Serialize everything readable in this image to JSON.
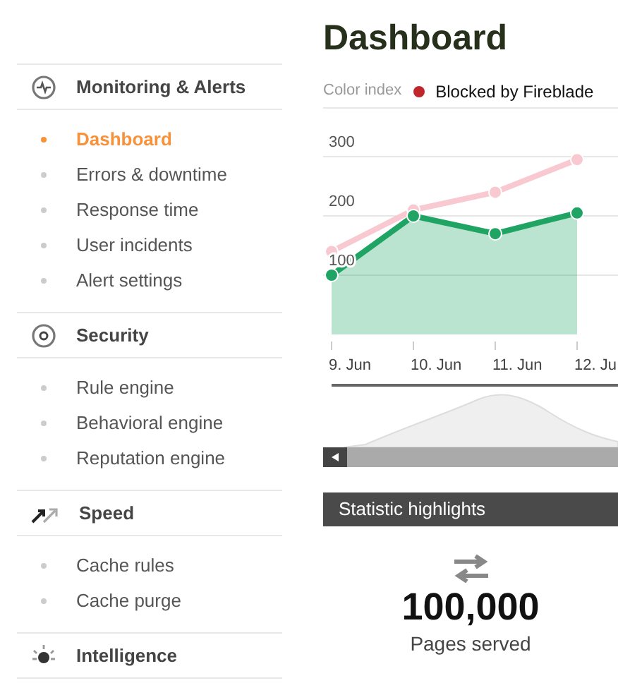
{
  "sidebar": {
    "sections": [
      {
        "title": "Monitoring & Alerts",
        "kind": "monitoring",
        "items": [
          {
            "label": "Dashboard",
            "selected": true
          },
          {
            "label": "Errors & downtime",
            "selected": false
          },
          {
            "label": "Response time",
            "selected": false
          },
          {
            "label": "User incidents",
            "selected": false
          },
          {
            "label": "Alert settings",
            "selected": false
          }
        ]
      },
      {
        "title": "Security",
        "kind": "security",
        "items": [
          {
            "label": "Rule engine",
            "selected": false
          },
          {
            "label": "Behavioral engine",
            "selected": false
          },
          {
            "label": "Reputation engine",
            "selected": false
          }
        ]
      },
      {
        "title": "Speed",
        "kind": "speed",
        "items": [
          {
            "label": "Cache rules",
            "selected": false
          },
          {
            "label": "Cache purge",
            "selected": false
          }
        ]
      },
      {
        "title": "Intelligence",
        "kind": "intelligence"
      }
    ]
  },
  "main": {
    "title": "Dashboard",
    "legend": {
      "label": "Color index",
      "entries": [
        {
          "name": "Blocked by Fireblade",
          "color": "#c0272d"
        }
      ]
    },
    "chart_data": {
      "type": "line",
      "grid": true,
      "categories": [
        "9. Jun",
        "10. Jun",
        "11. Jun",
        "12. Ju"
      ],
      "yticks": [
        100,
        200,
        300
      ],
      "ylim": [
        0,
        300
      ],
      "series": [
        {
          "type": "line",
          "marker": "circle",
          "color": "#f9c9d2",
          "values": [
            140,
            210,
            240,
            295
          ]
        },
        {
          "type": "area",
          "marker": "circle",
          "color": "#1fa463",
          "values": [
            100,
            200,
            170,
            205
          ]
        }
      ]
    },
    "highlights": {
      "title": "Statistic highlights",
      "stats": [
        {
          "kind": "transfer",
          "value": "100,000",
          "label": "Pages served"
        }
      ]
    }
  }
}
